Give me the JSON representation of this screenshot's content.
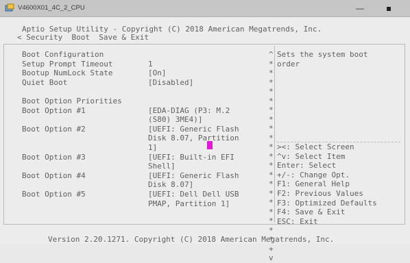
{
  "window": {
    "title": "V4600X01_4C_2_CPU",
    "minimize": "—"
  },
  "bios": {
    "header": "Aptio Setup Utility - Copyright (C) 2018 American Megatrends, Inc.",
    "nav": "< Security  Boot  Save & Exit",
    "footer": "Version 2.20.1271. Copyright (C) 2018 American Megatrends, Inc."
  },
  "settings": [
    {
      "label": "Boot Configuration",
      "value": []
    },
    {
      "label": "Setup Prompt Timeout",
      "value": [
        "1"
      ]
    },
    {
      "label": "Bootup NumLock State",
      "value": [
        "[On]"
      ]
    },
    {
      "label": "Quiet Boot",
      "value": [
        "[Disabled]"
      ]
    },
    {
      "label": "",
      "value": []
    },
    {
      "label": "Boot Option Priorities",
      "value": []
    },
    {
      "label": "Boot Option #1",
      "value": [
        "[EDA-DIAG (P3: M.2",
        "(S80) 3ME4)]"
      ]
    },
    {
      "label": "Boot Option #2",
      "value": [
        "[UEFI: Generic Flash",
        "Disk 8.07, Partition",
        "1]"
      ]
    },
    {
      "label": "Boot Option #3",
      "value": [
        "[UEFI: Built-in EFI",
        "Shell]"
      ]
    },
    {
      "label": "Boot Option #4",
      "value": [
        "[UEFI: Generic Flash",
        "Disk 8.07]"
      ]
    },
    {
      "label": "Boot Option #5",
      "value": [
        "[UEFI: Dell Dell USB",
        "PMAP, Partition 1]"
      ]
    }
  ],
  "help": {
    "description": [
      "Sets the system boot",
      "order"
    ],
    "keys": [
      "><: Select Screen",
      "^v: Select Item",
      "Enter: Select",
      "+/-: Change Opt.",
      "F1: General Help",
      "F2: Previous Values",
      "F3: Optimized Defaults",
      "F4: Save & Exit",
      "ESC: Exit"
    ]
  },
  "scroll": {
    "up": "^",
    "down": "v",
    "marks": [
      "*",
      "*",
      "*",
      "*",
      "*",
      "*",
      "*",
      "*",
      "*",
      "*",
      "*",
      "*",
      "*",
      "*",
      "*",
      "*",
      "*",
      "*",
      "*",
      "*",
      "*",
      "+"
    ]
  },
  "colors": {
    "titlebar": "#c6c6c6",
    "screen_bg": "#ececec",
    "text": "#5f5f5f",
    "cursor": "#e21ad8"
  }
}
